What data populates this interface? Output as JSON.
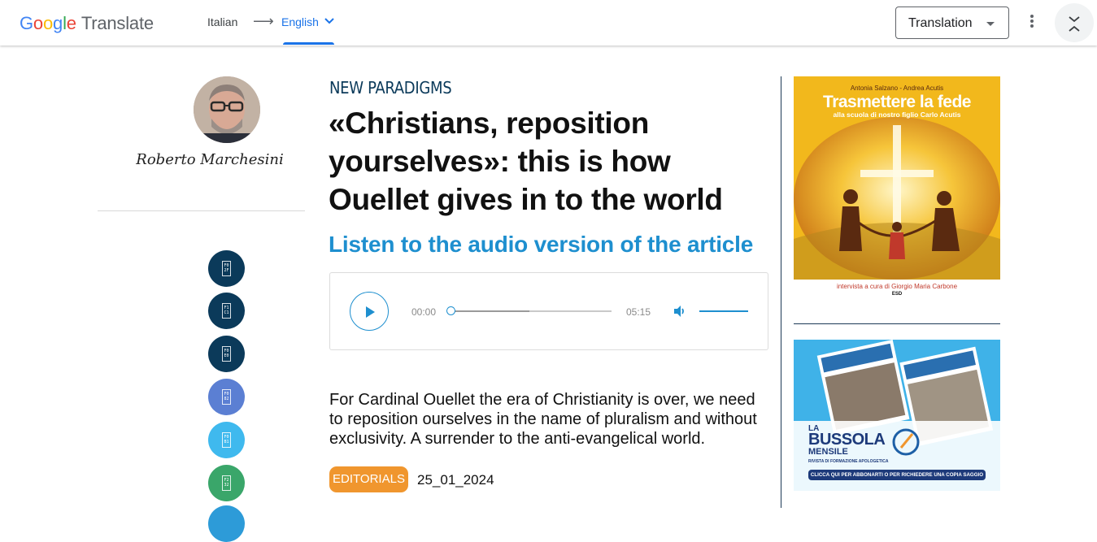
{
  "app": {
    "logo_google": [
      "G",
      "o",
      "o",
      "g",
      "l",
      "e"
    ],
    "logo_product": "Translate",
    "source_lang": "Italian",
    "target_lang": "English",
    "mode_label": "Translation"
  },
  "author": {
    "name": "Roberto Marchesini"
  },
  "share_buttons": [
    {
      "icon": "facebook-icon",
      "color": "#0b3a5a"
    },
    {
      "icon": "twitter-icon",
      "color": "#0b3a5a"
    },
    {
      "icon": "email-icon",
      "color": "#0b3a5a"
    },
    {
      "icon": "linkedin-icon",
      "color": "#5b7fd3"
    },
    {
      "icon": "telegram-icon",
      "color": "#3fb9ee"
    },
    {
      "icon": "whatsapp-icon",
      "color": "#3aa66a"
    }
  ],
  "article": {
    "kicker": "NEW PARADIGMS",
    "headline": "«Christians, reposition yourselves»: this is how Ouellet gives in to the world",
    "listen_label": "Listen to the audio version of the article",
    "summary": "For Cardinal Ouellet the era of Christianity is over, we need to reposition ourselves in the name of pluralism and without exclusivity. A surrender to the anti-evangelical world.",
    "category": "EDITORIALS",
    "date": "25_01_2024"
  },
  "player": {
    "current_time": "00:00",
    "duration": "05:15",
    "progress": 0,
    "volume": 1
  },
  "ads": {
    "book": {
      "authors": "Antonia Salzano - Andrea Acutis",
      "title": "Trasmettere la fede",
      "subtitle": "alla scuola di nostro figlio Carlo Acutis",
      "interview": "intervista a cura di Giorgio Maria Carbone",
      "publisher": "ESD"
    },
    "magazine": {
      "name_top": "LA",
      "name_main": "BUSSOLA",
      "name_sub": "MENSILE",
      "tagline": "RIVISTA DI FORMAZIONE APOLOGETICA",
      "cta": "CLICCA QUI PER ABBONARTI O PER RICHIEDERE UNA COPIA SAGGIO"
    }
  },
  "colors": {
    "accent_blue": "#1a73e8",
    "article_blue": "#1e8fcf",
    "tag_orange": "#f0962e",
    "navy": "#0b3a5a"
  }
}
